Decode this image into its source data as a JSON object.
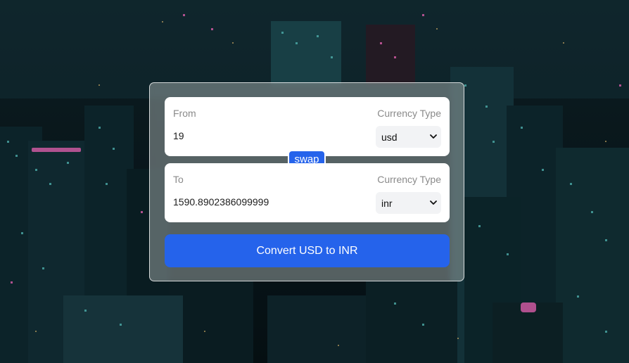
{
  "from": {
    "label": "From",
    "currency_type_label": "Currency Type",
    "amount": "19",
    "currency": "usd"
  },
  "to": {
    "label": "To",
    "currency_type_label": "Currency Type",
    "amount": "1590.8902386099999",
    "currency": "inr"
  },
  "swap_label": "swap",
  "convert_label": "Convert USD to INR",
  "colors": {
    "accent": "#2563eb",
    "card_border": "#ffffff",
    "field_background": "#ffffff",
    "label_text": "#8a8a8a"
  },
  "icons": {
    "select_arrow": "chevron-down-icon",
    "background": "city-night-skyline-image"
  }
}
